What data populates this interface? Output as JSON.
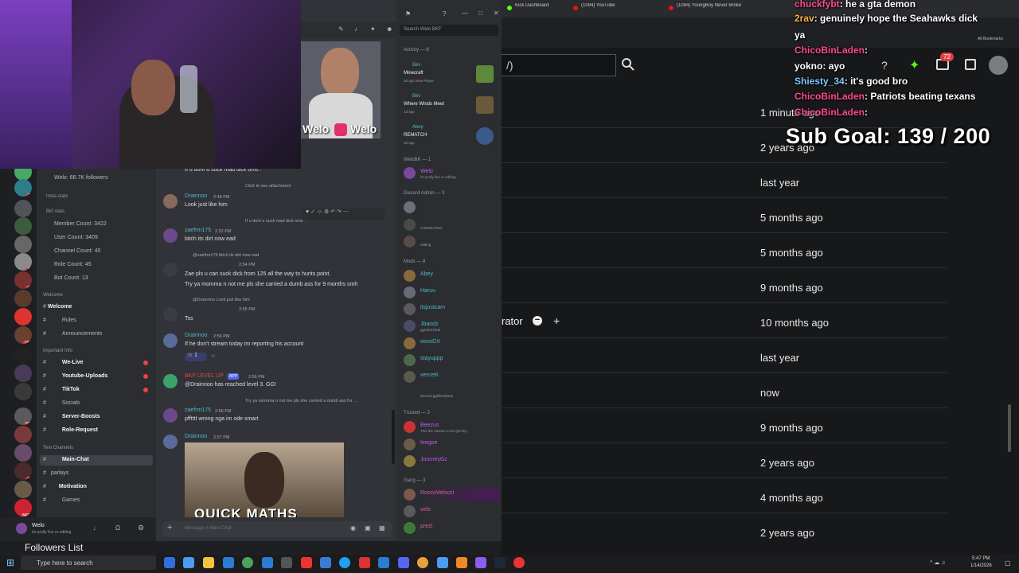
{
  "browser": {
    "tabs": [
      "Kick Dashboard",
      "(1094) YouTube",
      "(1094) YoungBoy Never Broke"
    ],
    "bookmarks_label": "All Bookmarks",
    "search_value": "/)"
  },
  "background_page": {
    "timestamps": [
      "1 minute ago",
      "2 years ago",
      "last year",
      "5 months ago",
      "5 months ago",
      "9 months ago",
      "10 months ago",
      "last year",
      "now",
      "9 months ago",
      "2 years ago",
      "4 months ago",
      "2 years ago"
    ],
    "role_label": "rator"
  },
  "stream_chat": [
    {
      "user": "chuckfybt",
      "text": "he a gta demon"
    },
    {
      "user": "2rav",
      "text": "genuinely hope the Seahawks dick"
    },
    {
      "user": "",
      "text": "ya"
    },
    {
      "user": "ChicoBinLaden",
      "text": ""
    },
    {
      "user": "yokno",
      "text": "ayo"
    },
    {
      "user": "Shiesty_34",
      "text": "it's good bro"
    },
    {
      "user": "ChicoBinLaden",
      "text": "Patriots beating texans"
    },
    {
      "user": "ChicoBinLaden",
      "text": ""
    }
  ],
  "notification_count": "72",
  "sub_goal": "Sub Goal:  139 / 200",
  "webcam_overlay": "Welo",
  "discord": {
    "search_placeholder": "Search Welo BKF",
    "server_stats": [
      "Welo: 66.7K followers",
      "Insta stats",
      "Bkf stats",
      "Member Count: 3422",
      "User Count: 3409",
      "Channel Count: 40",
      "Role Count: 45",
      "Bot Count: 13"
    ],
    "categories": [
      "Welcome",
      "Important Info",
      "Text Channels"
    ],
    "channels": [
      "Welcome",
      "Rules",
      "Announcements",
      "We-Live",
      "Youtube-Uploads",
      "TikTok",
      "Socials",
      "Server-Boosts",
      "Role-Request",
      "Main-Chat",
      "parlays",
      "Motivation",
      "Games"
    ],
    "messages": [
      {
        "user": "",
        "reply": "",
        "text": "If u dont u suck mad dick oms .",
        "color": "#dbdee1"
      },
      {
        "user": "Drainnoo",
        "reply": "Click to see attachment",
        "text": "Look just like him",
        "color": "#4fb8c9"
      },
      {
        "user": "zaefrm175",
        "reply": "If u dont u suck mad dick oms .",
        "text": "bitch its dirt now ead",
        "color": "#4fb8c9"
      },
      {
        "user": "",
        "reply": "@zaefrm175 bitch its dirt now ead",
        "text": "Zae pls u can suck dick from 125 all the way to hunts point.",
        "color": "#dbdee1"
      },
      {
        "user": "",
        "reply": "",
        "text": "Try ya momma n not me pls she carried a dumb ass for 9 months smh",
        "color": "#dbdee1"
      },
      {
        "user": "",
        "reply": "@Drainnoo Look just like him",
        "text": "Tss",
        "color": "#dbdee1"
      },
      {
        "user": "Drainnoo",
        "reply": "",
        "text": "If he don't stream today im reporting his account",
        "color": "#4fb8c9"
      },
      {
        "user": "BKF LEVEL UP",
        "reply": "",
        "text": "@Drainnoo has reached level 3. GG!",
        "color": "#e8453c"
      },
      {
        "user": "zaefrm175",
        "reply": "Try ya momma n not me pls she carried a dumb ass for ...",
        "text": "pfftttt wrong nga im ode smart",
        "color": "#4fb8c9"
      },
      {
        "user": "Drainnoo",
        "reply": "",
        "text": "",
        "color": "#4fb8c9"
      }
    ],
    "times": [
      "2:48 PM",
      "2:52 PM",
      "2:54 PM",
      "2:55 PM",
      "2:56 PM",
      "2:56 PM",
      "2:56 PM",
      "2:57 PM"
    ],
    "app_badge": "APP",
    "meme_text": "QUICK MATHS",
    "input_placeholder": "Message # Main-Chat",
    "user_panel": {
      "name": "Welo",
      "status": "im prolly live or editing"
    },
    "followers_list": "Followers List",
    "activity_header": "Activity — 8",
    "activities": [
      {
        "user": "Bév",
        "game": "Minecraft",
        "sub": "3d ago  New Player",
        "color": "#5c8a3a"
      },
      {
        "user": "Bév",
        "game": "Where Winds Meet",
        "sub": "1d ago",
        "color": "#6a5a3a"
      },
      {
        "user": "Abey",
        "game": "REMATCH",
        "sub": "2d ago",
        "color": "#3a5a8a"
      }
    ],
    "member_sections": [
      {
        "title": "WeloBK — 1",
        "members": [
          {
            "name": "Welo",
            "sub": "im prolly live or editing",
            "color": "#c05cf2"
          }
        ]
      },
      {
        "title": "Discord Admin — 3",
        "members": [
          {
            "name": "",
            "sub": "",
            "color": "#fff"
          },
          {
            "name": "",
            "sub": "THEREAPER",
            "color": "#fff"
          },
          {
            "name": "",
            "sub": "editing",
            "color": "#fff"
          }
        ]
      },
      {
        "title": "Mods — 8",
        "members": [
          {
            "name": "Abey",
            "sub": "",
            "color": "#4fb8c9"
          },
          {
            "name": "Haruu",
            "sub": "",
            "color": "#4fb8c9"
          },
          {
            "name": "itsjustcam",
            "sub": "",
            "color": "#4fb8c9"
          },
          {
            "name": "Jbandz",
            "sub": "gg/dmtr1f0al",
            "color": "#4fb8c9"
          },
          {
            "name": "oovoDX",
            "sub": "",
            "color": "#4fb8c9"
          },
          {
            "name": "stayuppp",
            "sub": "",
            "color": "#4fb8c9"
          },
          {
            "name": "vercetti",
            "sub": "",
            "color": "#4fb8c9"
          },
          {
            "name": "",
            "sub": "discord.gg/lifestylerp",
            "color": "#4fb8c9"
          }
        ]
      },
      {
        "title": "Trusted — 3",
        "members": [
          {
            "name": "Beezus",
            "sub": "This the season to be grinchy",
            "color": "#c05cf2"
          },
          {
            "name": "feegoe",
            "sub": "",
            "color": "#c05cf2"
          },
          {
            "name": "JourneyGz",
            "sub": "",
            "color": "#c05cf2"
          }
        ]
      },
      {
        "title": "Gang — 3",
        "members": [
          {
            "name": "RoccoVelocci",
            "sub": "",
            "color": "#e060a0"
          },
          {
            "name": "velo",
            "sub": "",
            "color": "#e060a0"
          },
          {
            "name": "prezi",
            "sub": "",
            "color": "#e060a0"
          }
        ]
      }
    ]
  },
  "taskbar": {
    "search_placeholder": "Type here to search",
    "time": "5:47 PM",
    "date": "1/14/2026"
  }
}
